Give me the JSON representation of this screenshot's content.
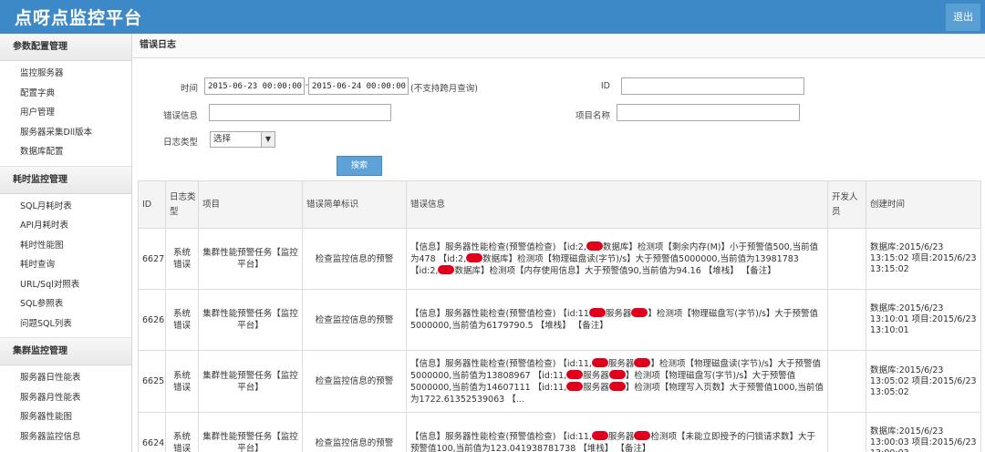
{
  "header": {
    "app_title": "点呀点监控平台",
    "logout_label": "退出"
  },
  "sidebar": {
    "sections": [
      {
        "title": "参数配置管理",
        "items": [
          "监控服务器",
          "配置字典",
          "用户管理",
          "服务器采集Dll版本",
          "数据库配置"
        ]
      },
      {
        "title": "耗时监控管理",
        "items": [
          "SQL月耗时表",
          "API月耗时表",
          "耗时性能图",
          "耗时查询",
          "URL/Sql对照表",
          "SQL参照表",
          "问题SQL列表"
        ]
      },
      {
        "title": "集群监控管理",
        "items": [
          "服务器日性能表",
          "服务器月性能表",
          "服务器性能图",
          "服务器监控信息"
        ]
      }
    ]
  },
  "page_title": "错误日志",
  "filters": {
    "time_label": "时间",
    "time_start": "2015-06-23 00:00:00",
    "time_sep": "-",
    "time_end": "2015-06-24 00:00:00",
    "time_note": "(不支持跨月查询)",
    "id_label": "ID",
    "id_value": "",
    "error_info_label": "错误信息",
    "error_info_value": "",
    "project_label": "项目名称",
    "project_value": "",
    "log_type_label": "日志类型",
    "log_type_value": "选择",
    "search_label": "搜索"
  },
  "table": {
    "headers": {
      "id": "ID",
      "type": "日志类型",
      "project": "项目",
      "brief": "错误简单标识",
      "info": "错误信息",
      "dev": "开发人员",
      "created": "创建时间"
    },
    "rows": [
      {
        "id": "6627",
        "type": "系统错误",
        "project": "集群性能预警任务【监控平台】",
        "brief": "检查监控信息的预警",
        "info": [
          "【信息】服务器性能检查(预警值检查) 【id:2,",
          "数据库】检测项【剩余内存(M)】小于预警值500,当前值为478 【id:2,",
          "数据库】检测项【物理磁盘读(字节)/s】大于预警值5000000,当前值为13981783 【id:2,",
          "数据库】检测项【内存使用信息】大于预警值90,当前值为94.16 【堆栈】 【备注】"
        ],
        "dev": "",
        "created": "数据库:2015/6/23 13:15:02 项目:2015/6/23 13:15:02"
      },
      {
        "id": "6626",
        "type": "系统错误",
        "project": "集群性能预警任务【监控平台】",
        "brief": "检查监控信息的预警",
        "info": [
          "【信息】服务器性能检查(预警值检查) 【id:11",
          "服务器",
          "】检测项【物理磁盘写(字节)/s】大于预警值5000000,当前值为6179790.5 【堆栈】 【备注】"
        ],
        "dev": "",
        "created": "数据库:2015/6/23 13:10:01 项目:2015/6/23 13:10:01"
      },
      {
        "id": "6625",
        "type": "系统错误",
        "project": "集群性能预警任务【监控平台】",
        "brief": "检查监控信息的预警",
        "info": [
          "【信息】服务器性能检查(预警值检查) 【id:11,",
          "服务器",
          "】检测项【物理磁盘读(字节)/s】大于预警值5000000,当前值为13808967 【id:11,",
          "服务器",
          "】检测项【物理磁盘写(字节)/s】大于预警值5000000,当前值为14607111 【id:11,",
          "服务器",
          "】检测项【物理写入页数】大于预警值1000,当前值为1722.61352539063 【..."
        ],
        "dev": "",
        "created": "数据库:2015/6/23 13:05:02 项目:2015/6/23 13:05:02"
      },
      {
        "id": "6624",
        "type": "系统错误",
        "project": "集群性能预警任务【监控平台】",
        "brief": "检查监控信息的预警",
        "info": [
          "【信息】服务器性能检查(预警值检查) 【id:11,",
          "服务器",
          "检测项【未能立即授予的闩锁请求数】大于预警值100,当前值为123.041938781738 【堆栈】 【备注】"
        ],
        "dev": "",
        "created": "数据库:2015/6/23 13:00:03 项目:2015/6/23 13:00:03"
      }
    ]
  }
}
